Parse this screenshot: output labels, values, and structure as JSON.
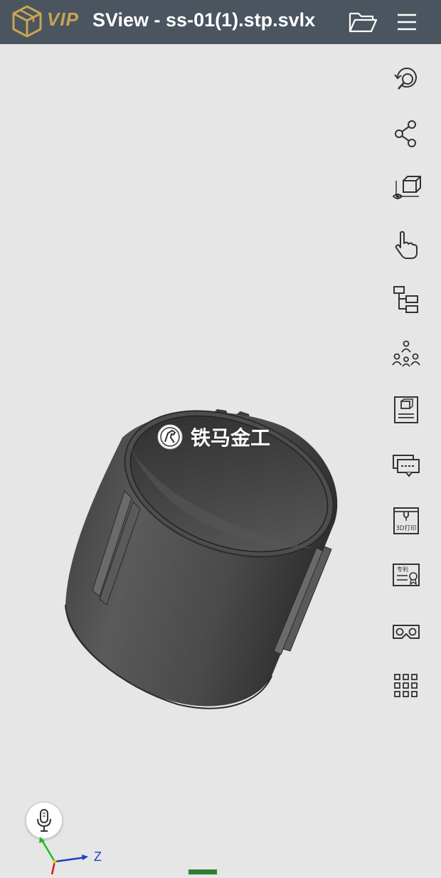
{
  "app": {
    "badge": "VIP",
    "title": "SView - ss-01(1).stp.svlx"
  },
  "header_icons": [
    "open-folder-icon",
    "menu-icon"
  ],
  "toolbar": [
    {
      "name": "rotate-zoom-icon"
    },
    {
      "name": "share-icon"
    },
    {
      "name": "view-cube-eye-icon"
    },
    {
      "name": "touch-hand-icon"
    },
    {
      "name": "model-tree-icon"
    },
    {
      "name": "assembly-icon"
    },
    {
      "name": "model-info-icon"
    },
    {
      "name": "annotation-icon"
    },
    {
      "name": "3d-print-icon",
      "label": "3D打印"
    },
    {
      "name": "patent-icon",
      "label": "专利"
    },
    {
      "name": "vr-glasses-icon"
    },
    {
      "name": "more-apps-icon"
    }
  ],
  "watermark": {
    "text": "铁马金工"
  },
  "axes": {
    "z_label": "Z"
  },
  "colors": {
    "header": "#4a5560",
    "background": "#e6e6e6",
    "vip_gold": "#c9a451",
    "axis_z": "#1b3fc7",
    "axis_y": "#1bbf1b",
    "axis_x": "#d21b1b"
  }
}
